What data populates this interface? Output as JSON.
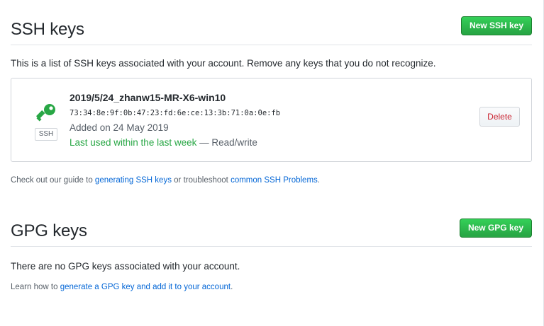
{
  "ssh_section": {
    "title": "SSH keys",
    "new_button_label": "New SSH key",
    "intro_text": "This is a list of SSH keys associated with your account. Remove any keys that you do not recognize.",
    "keys": [
      {
        "title": "2019/5/24_zhanw15-MR-X6-win10",
        "fingerprint": "73:34:8e:9f:0b:47:23:fd:6e:ce:13:3b:71:0a:0e:fb",
        "added": "Added on 24 May 2019",
        "last_used": "Last used within the last week",
        "access": " — Read/write",
        "badge": "SSH",
        "delete_label": "Delete"
      }
    ],
    "guide": {
      "prefix": "Check out our guide to ",
      "link1": "generating SSH keys",
      "middle": " or troubleshoot ",
      "link2": "common SSH Problems",
      "suffix": "."
    }
  },
  "gpg_section": {
    "title": "GPG keys",
    "new_button_label": "New GPG key",
    "empty_text": "There are no GPG keys associated with your account.",
    "learn": {
      "prefix": "Learn how to ",
      "link": "generate a GPG key and add it to your account",
      "suffix": "."
    }
  },
  "colors": {
    "primary_green": "#28a745",
    "link_blue": "#0366d6",
    "danger_red": "#cb2431",
    "key_icon_green": "#28a745"
  },
  "icons": {
    "key_icon": "key-icon"
  }
}
